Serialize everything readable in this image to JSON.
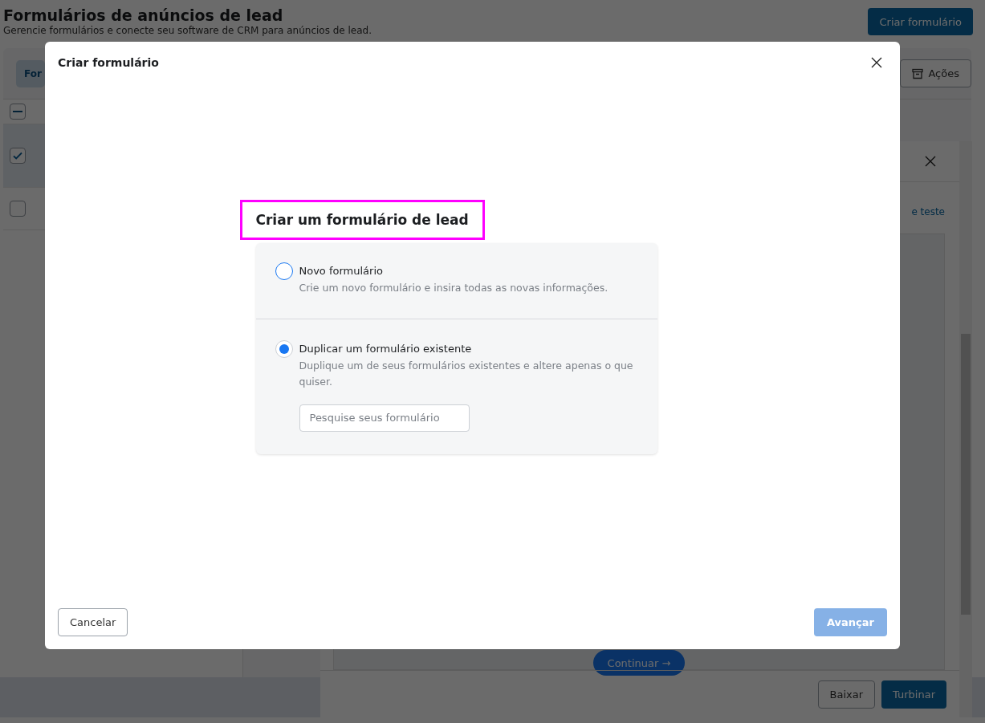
{
  "page": {
    "title": "Formulários de anúncios de lead",
    "subtitle": "Gerencie formulários e conecte seu software de CRM para anúncios de lead.",
    "create_button": "Criar formulário"
  },
  "list_panel": {
    "tab": {
      "label": "For",
      "selected": true
    },
    "header_checkbox": {
      "indeterminate": true
    },
    "rows": [
      {
        "checked": true,
        "selected": true
      },
      {
        "checked": false,
        "selected": false
      }
    ],
    "actions_button": "Ações"
  },
  "drawer": {
    "link": "e teste",
    "continue_button": "Continuar →",
    "buttons": [
      "Baixar",
      "Turbinar"
    ]
  },
  "dialog": {
    "title": "Criar formulário",
    "heading": "Criar um formulário de lead",
    "options": [
      {
        "label": "Novo formulário",
        "description": "Crie um novo formulário e insira todas as novas informações.",
        "selected": false
      },
      {
        "label": "Duplicar um formulário existente",
        "description": "Duplique um de seus formulários existentes e altere apenas o que quiser.",
        "selected": true,
        "search": {
          "placeholder": "Pesquise seus formulário"
        }
      }
    ],
    "cancel_button": "Cancelar",
    "next_button": {
      "label": "Avançar",
      "disabled": true
    }
  }
}
